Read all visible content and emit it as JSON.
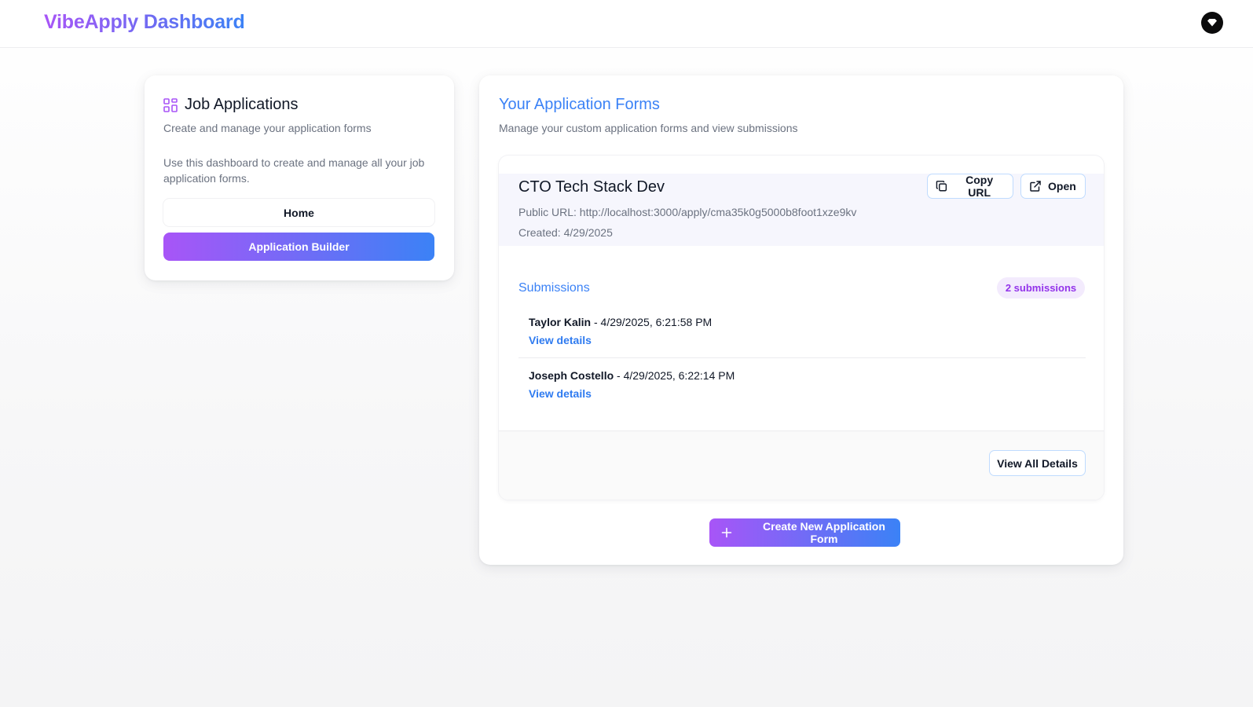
{
  "app": {
    "title": "VibeApply Dashboard"
  },
  "sidebar": {
    "title": "Job Applications",
    "subtitle": "Create and manage your application forms",
    "description": "Use this dashboard to create and manage all your job application forms.",
    "nav": {
      "home_label": "Home",
      "builder_label": "Application Builder"
    },
    "icon": "layout-grid-icon"
  },
  "main": {
    "title": "Your Application Forms",
    "subtitle": "Manage your custom application forms and view submissions",
    "form": {
      "name": "CTO Tech Stack Dev",
      "public_url": "Public URL: http://localhost:3000/apply/cma35k0g5000b8foot1xze9kv",
      "created": "Created: 4/29/2025",
      "copy_label": "Copy URL",
      "open_label": "Open",
      "submissions_title": "Submissions",
      "submissions_count": "2 submissions",
      "submissions": [
        {
          "name": "Taylor Kalin",
          "timestamp": " - 4/29/2025, 6:21:58 PM",
          "link": "View details"
        },
        {
          "name": "Joseph Costello",
          "timestamp": " - 4/29/2025, 6:22:14 PM",
          "link": "View details"
        }
      ],
      "view_all_label": "View All Details"
    },
    "create_label": "Create New Application Form"
  },
  "colors": {
    "accent_purple": "#a855f7",
    "accent_blue": "#3b82f6",
    "badge_bg": "#f3ebfd"
  }
}
